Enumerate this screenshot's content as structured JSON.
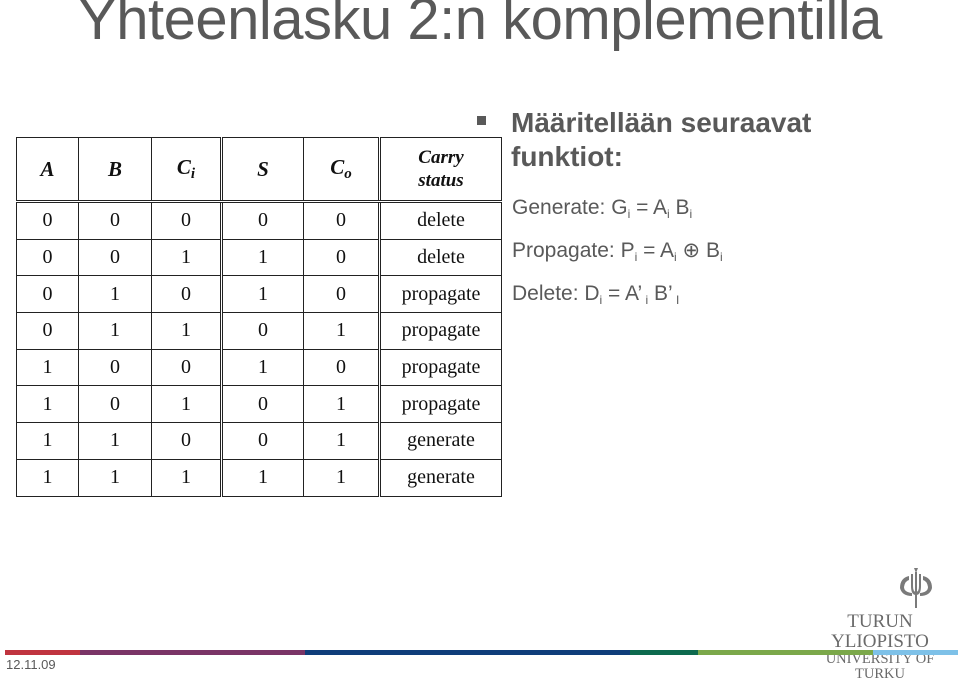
{
  "slide": {
    "title": "Yhteenlasku 2:n komplementilla",
    "date": "12.11.09"
  },
  "table": {
    "headers": [
      {
        "main": "A",
        "sub": ""
      },
      {
        "main": "B",
        "sub": ""
      },
      {
        "main": "C",
        "sub": "i"
      },
      {
        "main": "S",
        "sub": ""
      },
      {
        "main": "C",
        "sub": "o"
      },
      {
        "main": "Carry",
        "sub": "status"
      }
    ],
    "rows": [
      [
        "0",
        "0",
        "0",
        "0",
        "0",
        "delete"
      ],
      [
        "0",
        "0",
        "1",
        "1",
        "0",
        "delete"
      ],
      [
        "0",
        "1",
        "0",
        "1",
        "0",
        "propagate"
      ],
      [
        "0",
        "1",
        "1",
        "0",
        "1",
        "propagate"
      ],
      [
        "1",
        "0",
        "0",
        "1",
        "0",
        "propagate"
      ],
      [
        "1",
        "0",
        "1",
        "0",
        "1",
        "propagate"
      ],
      [
        "1",
        "1",
        "0",
        "0",
        "1",
        "generate"
      ],
      [
        "1",
        "1",
        "1",
        "1",
        "1",
        "generate"
      ]
    ]
  },
  "bullet": {
    "text": "Määritellään seuraavat funktiot:"
  },
  "functions": {
    "generate": {
      "label": "Generate: G",
      "sub1": "i",
      "eq": " = A",
      "sub2": "i",
      "mid": " B",
      "sub3": "i"
    },
    "propagate": {
      "label": "Propagate: P",
      "sub1": "i",
      "eq": " = A",
      "sub2": "i",
      "mid": " ⊕  B",
      "sub3": "i"
    },
    "delete": {
      "label": "Delete: D",
      "sub1": "i",
      "eq": " = A’",
      "sub2": " i",
      "mid": " B’",
      "sub3": " I"
    }
  },
  "logo": {
    "line1": "TURUN YLIOPISTO",
    "line2": "UNIVERSITY OF TURKU"
  },
  "colorbar": {
    "colors": [
      "#c0343f",
      "#7a3466",
      "#0f3d7a",
      "#0d6a4e",
      "#7ba84a",
      "#7ec1e8"
    ]
  }
}
